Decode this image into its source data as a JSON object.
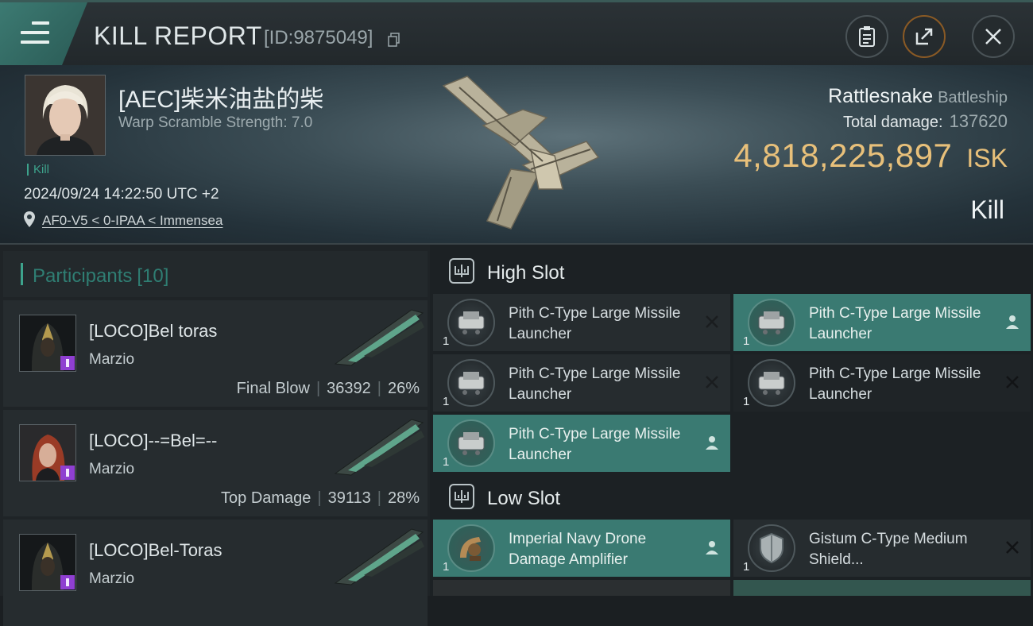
{
  "header": {
    "title": "KILL REPORT",
    "report_id": "[ID:9875049]"
  },
  "victim": {
    "pilot": "[AEC]柴米油盐的柴",
    "warp_scramble": "Warp Scramble Strength: 7.0",
    "result_tag": "Kill",
    "timestamp": "2024/09/24 14:22:50 UTC +2",
    "location": "AF0-V5 < 0-IPAA < Immensea",
    "ship_name": "Rattlesnake",
    "ship_class": "Battleship",
    "total_damage_label": "Total damage:",
    "total_damage": "137620",
    "isk_value": "4,818,225,897",
    "isk_unit": "ISK",
    "result": "Kill"
  },
  "participants": {
    "label": "Participants",
    "count": "[10]",
    "rows": [
      {
        "name": "[LOCO]Bel toras",
        "ship": "Marzio",
        "role": "Final Blow",
        "damage": "36392",
        "percent": "26%"
      },
      {
        "name": "[LOCO]--=Bel=--",
        "ship": "Marzio",
        "role": "Top Damage",
        "damage": "39113",
        "percent": "28%"
      },
      {
        "name": "[LOCO]Bel-Toras",
        "ship": "Marzio",
        "role": "",
        "damage": "",
        "percent": ""
      }
    ]
  },
  "slots": {
    "high": {
      "label": "High Slot",
      "modules": [
        {
          "name": "Pith C-Type Large Missile Launcher",
          "qty": "1",
          "state": "destroyed"
        },
        {
          "name": "Pith C-Type Large Missile Launcher",
          "qty": "1",
          "state": "dropped"
        },
        {
          "name": "Pith C-Type Large Missile Launcher",
          "qty": "1",
          "state": "destroyed"
        },
        {
          "name": "Pith C-Type Large Missile Launcher",
          "qty": "1",
          "state": "destroyed"
        },
        {
          "name": "Pith C-Type Large Missile Launcher",
          "qty": "1",
          "state": "dropped"
        }
      ]
    },
    "low": {
      "label": "Low Slot",
      "modules": [
        {
          "name": "Imperial Navy Drone Damage Amplifier",
          "qty": "1",
          "state": "dropped"
        },
        {
          "name": "Gistum C-Type Medium Shield...",
          "qty": "1",
          "state": "destroyed"
        }
      ]
    }
  },
  "colors": {
    "accent": "#3da38c",
    "isk": "#e8c07a",
    "fitted_bg": "#3a7a72"
  }
}
